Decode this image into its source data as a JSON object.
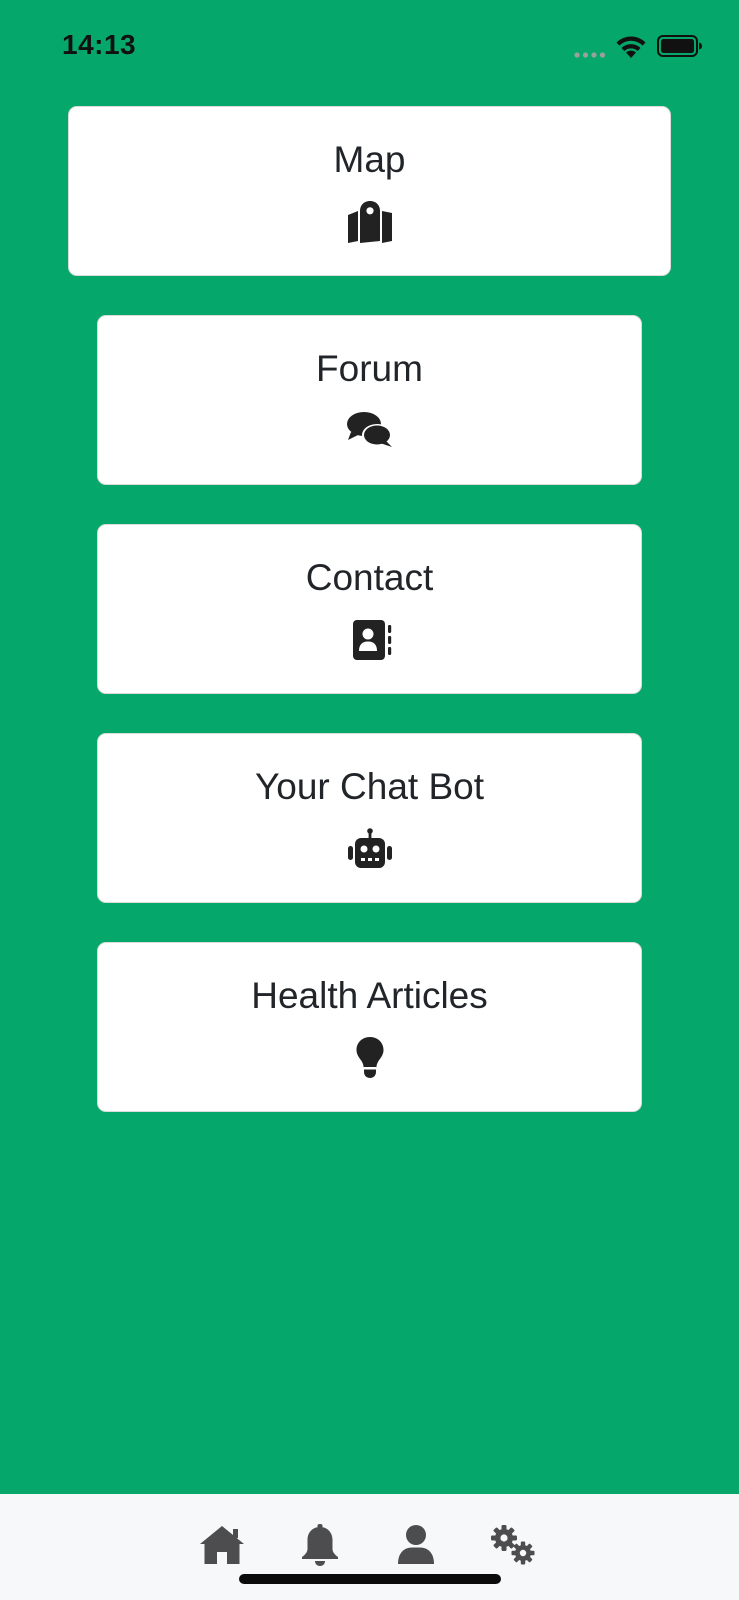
{
  "status_bar": {
    "time": "14:13"
  },
  "menu": {
    "items": [
      {
        "label": "Map",
        "icon": "map-location-icon"
      },
      {
        "label": "Forum",
        "icon": "comments-icon"
      },
      {
        "label": "Contact",
        "icon": "address-book-icon"
      },
      {
        "label": "Your Chat Bot",
        "icon": "robot-icon"
      },
      {
        "label": "Health Articles",
        "icon": "lightbulb-icon"
      }
    ]
  },
  "tab_bar": {
    "items": [
      {
        "icon": "home-icon"
      },
      {
        "icon": "bell-icon"
      },
      {
        "icon": "user-icon"
      },
      {
        "icon": "gears-icon"
      }
    ]
  },
  "colors": {
    "background": "#05a76a",
    "card": "#ffffff",
    "text": "#212529",
    "tab_bar": "#f7f8f9",
    "tab_icon": "#4d4d4f"
  }
}
